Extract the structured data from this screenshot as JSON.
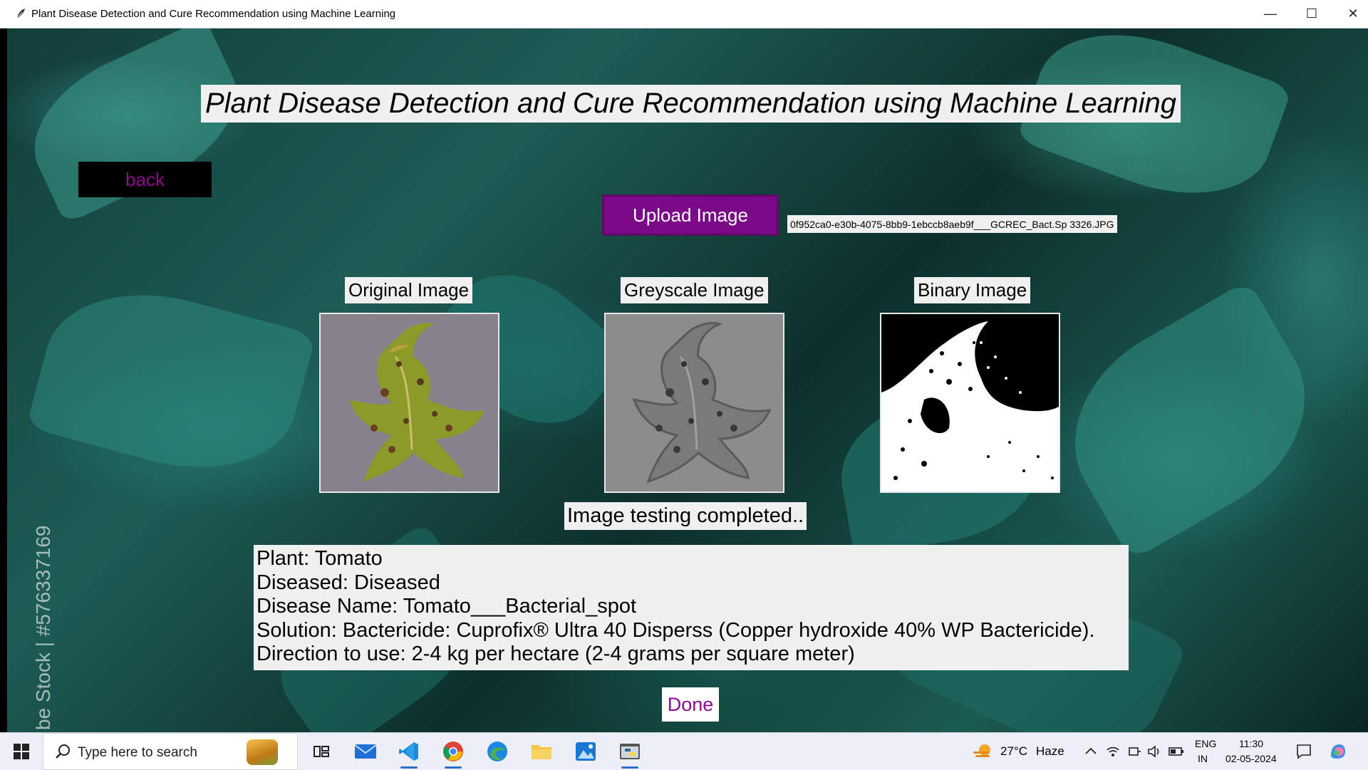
{
  "window": {
    "title": "Plant Disease Detection and Cure Recommendation using Machine Learning",
    "minimize_glyph": "—",
    "maximize_glyph": "☐",
    "close_glyph": "✕"
  },
  "app": {
    "heading": "Plant Disease Detection and Cure Recommendation using Machine Learning",
    "back_label": "back",
    "upload_label": "Upload Image",
    "filename": "0f952ca0-e30b-4075-8bb9-1ebccb8aeb9f___GCREC_Bact.Sp 3326.JPG",
    "images": [
      {
        "label": "Original Image"
      },
      {
        "label": "Greyscale Image"
      },
      {
        "label": "Binary Image"
      }
    ],
    "status": "Image testing completed..",
    "result": {
      "plant": "Plant: Tomato",
      "diseased": "Diseased: Diseased",
      "disease_name": "Disease Name: Tomato___Bacterial_spot",
      "solution": "Solution: Bactericide: Cuprofix® Ultra 40 Disperss (Copper hydroxide 40% WP Bactericide).",
      "direction": "Direction to use: 2-4 kg per hectare (2-4 grams per square meter)"
    },
    "done_label": "Done",
    "watermark": "be Stock | #576337169"
  },
  "taskbar": {
    "search_placeholder": "Type here to search",
    "pinned": [
      "task-view",
      "mail",
      "vscode",
      "chrome",
      "edge",
      "file-explorer",
      "photos",
      "python-app"
    ],
    "weather": {
      "temp": "27°C",
      "condition": "Haze"
    },
    "language": {
      "lang": "ENG",
      "region": "IN"
    },
    "clock": {
      "time": "11:30",
      "date": "02-05-2024"
    }
  },
  "colors": {
    "accent_purple": "#7a0a87",
    "back_text": "#8e0a8e",
    "panel_bg": "#f0f0f0"
  }
}
